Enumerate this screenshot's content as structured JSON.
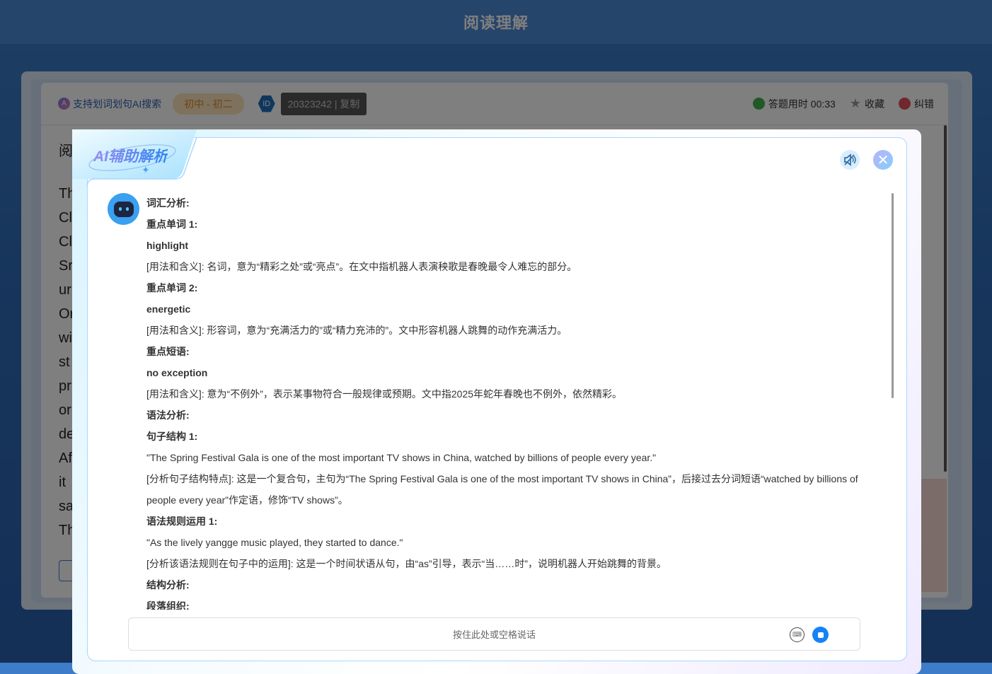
{
  "page_title": "阅读理解",
  "toolbar": {
    "ai_search": "支持划词划句AI搜索",
    "grade": "初中 - 初二",
    "id_badge": "ID",
    "id_value": "20323242 | 复制",
    "timer": "答题用时 00:33",
    "favorite": "收藏",
    "report": "纠错"
  },
  "background_text_fragments": [
    "阅",
    "Th",
    "Cl",
    "Cl",
    "Sr",
    "ur",
    "Or",
    "wi",
    "st",
    "pr",
    "or",
    "de",
    "Af",
    "it",
    "sa",
    "Th"
  ],
  "modal": {
    "title": "AI辅助解析",
    "lines": [
      {
        "text": "词汇分析:",
        "bold": true
      },
      {
        "text": "重点单词 1:",
        "bold": true
      },
      {
        "text": "highlight",
        "bold": true
      },
      {
        "text": "[用法和含义]: 名词，意为“精彩之处”或“亮点”。在文中指机器人表演秧歌是春晚最令人难忘的部分。",
        "bold": false
      },
      {
        "text": "重点单词 2:",
        "bold": true
      },
      {
        "text": "energetic",
        "bold": true
      },
      {
        "text": "[用法和含义]: 形容词，意为“充满活力的”或“精力充沛的”。文中形容机器人跳舞的动作充满活力。",
        "bold": false
      },
      {
        "text": "重点短语:",
        "bold": true
      },
      {
        "text": "no exception",
        "bold": true
      },
      {
        "text": "[用法和含义]: 意为“不例外”，表示某事物符合一般规律或预期。文中指2025年蛇年春晚也不例外，依然精彩。",
        "bold": false
      },
      {
        "text": "语法分析:",
        "bold": true
      },
      {
        "text": "句子结构 1:",
        "bold": true
      },
      {
        "text": "\"The Spring Festival Gala is one of the most important TV shows in China, watched by billions of people every year.\"",
        "bold": false
      },
      {
        "text": "[分析句子结构特点]: 这是一个复合句，主句为“The Spring Festival Gala is one of the most important TV shows in China”，后接过去分词短语“watched by billions of people every year”作定语，修饰“TV shows”。",
        "bold": false
      },
      {
        "text": "语法规则运用 1:",
        "bold": true
      },
      {
        "text": "\"As the lively yangge music played, they started to dance.\"",
        "bold": false
      },
      {
        "text": "[分析该语法规则在句子中的运用]: 这是一个时间状语从句，由“as”引导，表示“当……时”，说明机器人开始跳舞的背景。",
        "bold": false
      },
      {
        "text": "结构分析:",
        "bold": true
      },
      {
        "text": "段落组织:",
        "bold": true
      }
    ],
    "input_placeholder": "按住此处或空格说话",
    "keyboard_label": "⌨"
  }
}
